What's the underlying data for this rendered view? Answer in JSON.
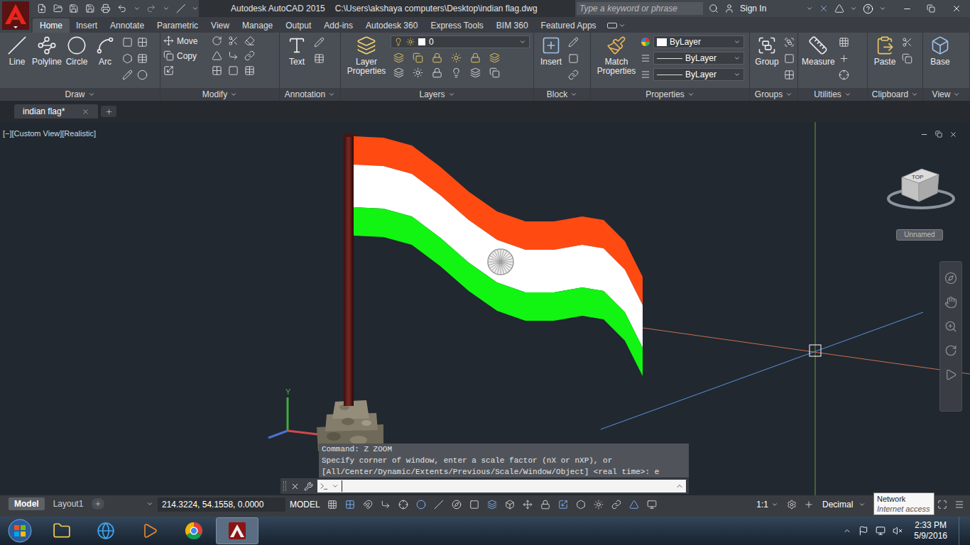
{
  "app": {
    "title": "Autodesk AutoCAD 2015",
    "path": "C:\\Users\\akshaya computers\\Desktop\\indian flag.dwg"
  },
  "search": {
    "placeholder": "Type a keyword or phrase"
  },
  "account": {
    "label": "Sign In"
  },
  "ribbon_tabs": [
    {
      "label": "Home",
      "selected": true
    },
    {
      "label": "Insert",
      "selected": false
    },
    {
      "label": "Annotate",
      "selected": false
    },
    {
      "label": "Parametric",
      "selected": false
    },
    {
      "label": "View",
      "selected": false
    },
    {
      "label": "Manage",
      "selected": false
    },
    {
      "label": "Output",
      "selected": false
    },
    {
      "label": "Add-ins",
      "selected": false
    },
    {
      "label": "Autodesk 360",
      "selected": false
    },
    {
      "label": "Express Tools",
      "selected": false
    },
    {
      "label": "BIM 360",
      "selected": false
    },
    {
      "label": "Featured Apps",
      "selected": false
    }
  ],
  "ribbon_panels": [
    {
      "title": "Draw",
      "large_tools": [
        "Line",
        "Polyline",
        "Circle",
        "Arc"
      ]
    },
    {
      "title": "Modify",
      "small_tools": [
        "Move",
        "Copy"
      ]
    },
    {
      "title": "Annotation",
      "large_tools": [
        "Text"
      ]
    },
    {
      "title": "Layers",
      "large_tools": [
        "Layer Properties"
      ],
      "layer": "0"
    },
    {
      "title": "Block",
      "large_tools": [
        "Insert"
      ]
    },
    {
      "title": "Properties",
      "large_tools": [
        "Match Properties"
      ],
      "dropdowns": [
        "ByLayer",
        "ByLayer",
        "ByLayer"
      ]
    },
    {
      "title": "Groups",
      "large_tools": [
        "Group"
      ]
    },
    {
      "title": "Utilities",
      "large_tools": [
        "Measure"
      ]
    },
    {
      "title": "Clipboard",
      "large_tools": [
        "Paste"
      ]
    },
    {
      "title": "View",
      "large_tools": [
        "Base"
      ]
    }
  ],
  "file_tabs": [
    {
      "label": "indian flag*",
      "selected": true
    }
  ],
  "viewport": {
    "controls": [
      "[−]",
      "[Custom View]",
      "[Realistic]"
    ]
  },
  "viewcube": {
    "face": "TOP",
    "view_name": "Unnamed"
  },
  "ucs": {
    "y_label": "Y"
  },
  "command_history": [
    "Command: Z ZOOM",
    "Specify corner of window, enter a scale factor (nX or nXP), or",
    "[All/Center/Dynamic/Extents/Previous/Scale/Window/Object] <real time>: e"
  ],
  "command_input": {
    "value": ""
  },
  "layout_tabs": [
    {
      "label": "Model",
      "selected": true
    },
    {
      "label": "Layout1",
      "selected": false
    }
  ],
  "status_bar": {
    "coordinates": "214.3224, 54.1558, 0.0000",
    "space": "MODEL",
    "annotation_scale": "1:1",
    "units": "Decimal"
  },
  "tooltip": {
    "title": "Network",
    "detail": "Internet access"
  },
  "taskbar": {
    "time": "2:33 PM",
    "date": "5/9/2016"
  }
}
